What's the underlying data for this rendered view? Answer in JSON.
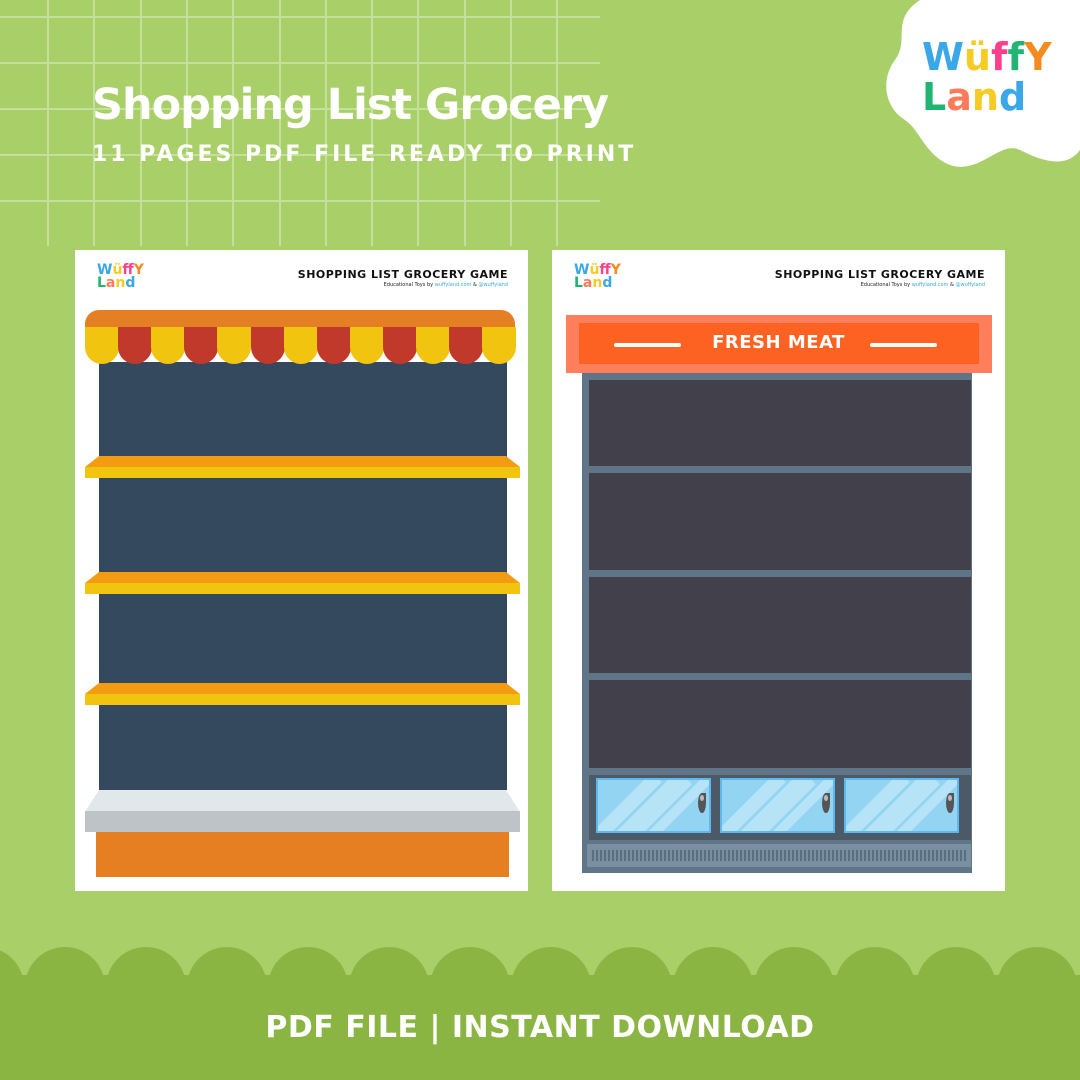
{
  "header": {
    "title": "Shopping List Grocery",
    "subtitle": "11 PAGES PDF FILE READY TO PRINT"
  },
  "brand": {
    "logo_line1": [
      "W",
      "ü",
      "f",
      "f",
      "Y"
    ],
    "logo_line2": [
      "L",
      "a",
      "n",
      "d"
    ],
    "logo_colors_line1": [
      "#3aa7e8",
      "#f5cb24",
      "#ff3f8a",
      "#21b573",
      "#f58a1f"
    ],
    "logo_colors_line2": [
      "#21b573",
      "#ff7a59",
      "#f5cb24",
      "#3aa7e8"
    ]
  },
  "pages": [
    {
      "title": "SHOPPING LIST GROCERY GAME",
      "sub_prefix": "Educational Toys by",
      "sub_site": "wuffyland.com",
      "sub_amp": "&",
      "sub_handle": "@wuffyland",
      "scene": "shelf",
      "shelf_count": 3,
      "awning_colors": [
        "#f1c40f",
        "#c0392b"
      ]
    },
    {
      "title": "SHOPPING LIST GROCERY GAME",
      "sub_prefix": "Educational Toys by",
      "sub_site": "wuffyland.com",
      "sub_amp": "&",
      "sub_handle": "@wuffyland",
      "scene": "cooler",
      "sign_label": "FRESH MEAT",
      "shelf_count": 4,
      "door_count": 3
    }
  ],
  "footer": {
    "text": "PDF FILE | INSTANT DOWNLOAD"
  },
  "colors": {
    "background": "#a9cf68",
    "footer": "#8ab542",
    "sign": "#fe6222"
  }
}
